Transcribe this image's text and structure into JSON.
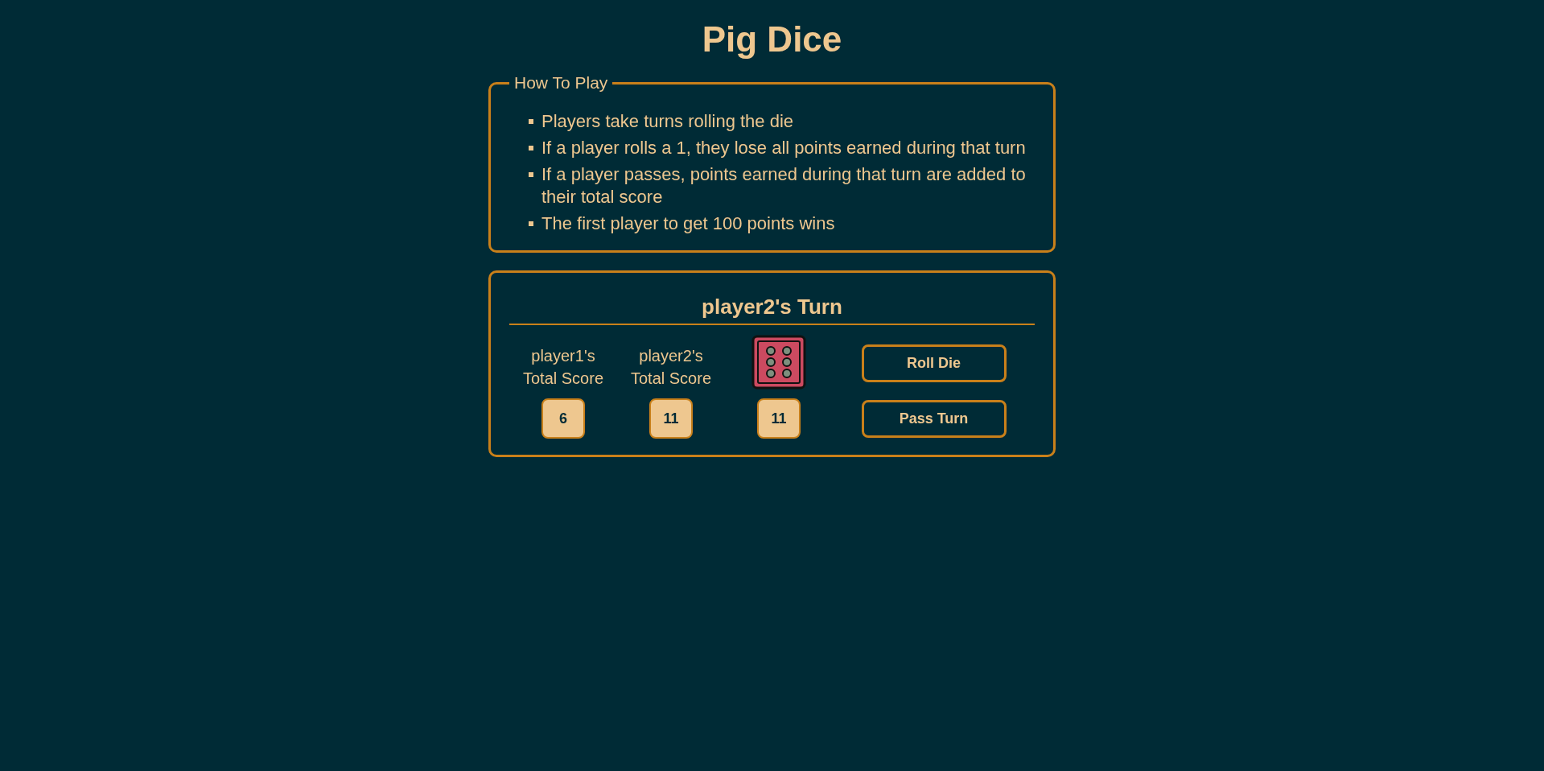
{
  "title": "Pig Dice",
  "how_to_play": {
    "legend": "How To Play",
    "rules": [
      "Players take turns rolling the die",
      "If a player rolls a 1, they lose all points earned during that turn",
      "If a player passes, points earned during that turn are added to their total score",
      "The first player to get 100 points wins"
    ]
  },
  "game": {
    "turn_heading": "player2's Turn",
    "scores": [
      {
        "label": "player1's Total Score",
        "value": "6"
      },
      {
        "label": "player2's Total Score",
        "value": "11"
      }
    ],
    "column_3": {
      "value": "11"
    },
    "buttons": [
      "Roll Die",
      "Pass Turn"
    ]
  }
}
